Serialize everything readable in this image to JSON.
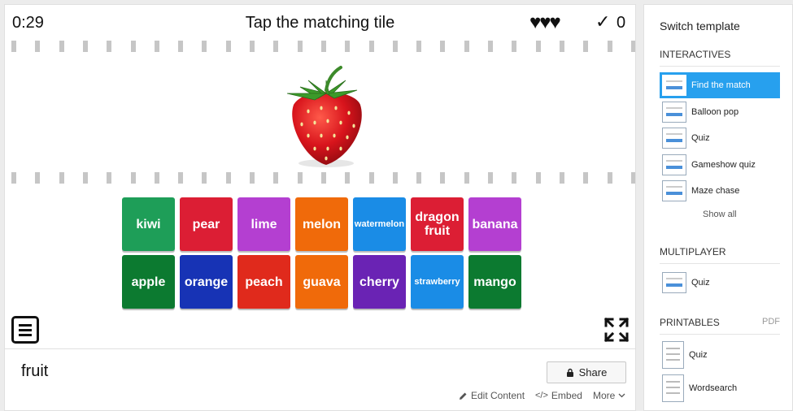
{
  "game": {
    "timer": "0:29",
    "instruction": "Tap the matching tile",
    "lives": "♥♥♥",
    "check_icon": "✓",
    "score": "0",
    "prompt_image": "strawberry-image",
    "tiles": [
      {
        "label": "kiwi",
        "color": "#1e9e58"
      },
      {
        "label": "pear",
        "color": "#dc1e34"
      },
      {
        "label": "lime",
        "color": "#b43fd1"
      },
      {
        "label": "melon",
        "color": "#f06a0a"
      },
      {
        "label": "watermelon",
        "color": "#1a8ce6"
      },
      {
        "label": "dragon fruit",
        "color": "#dc1e34"
      },
      {
        "label": "banana",
        "color": "#b43fd1"
      },
      {
        "label": "apple",
        "color": "#0c7a30"
      },
      {
        "label": "orange",
        "color": "#1733b5"
      },
      {
        "label": "peach",
        "color": "#e02a1c"
      },
      {
        "label": "guava",
        "color": "#f06a0a"
      },
      {
        "label": "cherry",
        "color": "#6a23b4"
      },
      {
        "label": "strawberry",
        "color": "#1a8ce6"
      },
      {
        "label": "mango",
        "color": "#0c7a30"
      }
    ]
  },
  "activity": {
    "title": "fruit",
    "share_label": "Share",
    "edit_label": "Edit Content",
    "embed_label": "Embed",
    "more_label": "More"
  },
  "sidebar": {
    "title": "Switch template",
    "interactives_heading": "INTERACTIVES",
    "interactives": [
      {
        "label": "Find the match",
        "active": true
      },
      {
        "label": "Balloon pop",
        "active": false
      },
      {
        "label": "Quiz",
        "active": false
      },
      {
        "label": "Gameshow quiz",
        "active": false
      },
      {
        "label": "Maze chase",
        "active": false
      }
    ],
    "show_all_label": "Show all",
    "multiplayer_heading": "MULTIPLAYER",
    "multiplayer": [
      {
        "label": "Quiz"
      }
    ],
    "printables_heading": "PRINTABLES",
    "pdf_label": "PDF",
    "printables": [
      {
        "label": "Quiz"
      },
      {
        "label": "Wordsearch"
      }
    ]
  }
}
